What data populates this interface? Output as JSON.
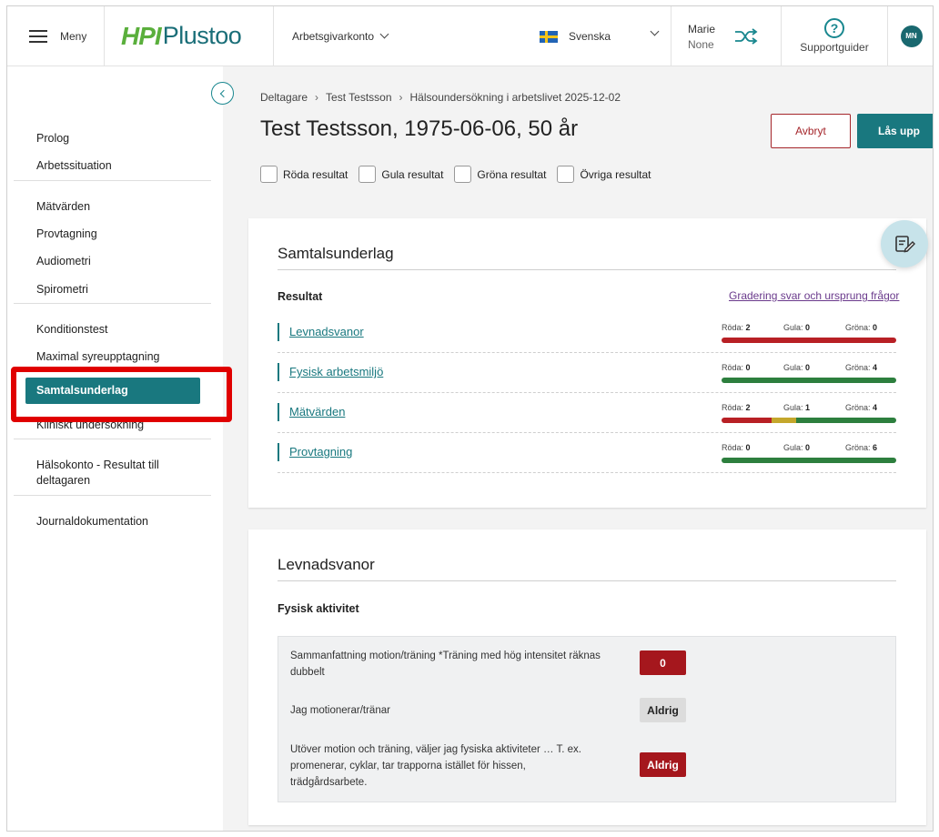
{
  "header": {
    "menu_label": "Meny",
    "logo_hpi": "HPI",
    "logo_plustoo": "Plustoo",
    "account_label": "Arbetsgivarkonto",
    "language_label": "Svenska",
    "user_name": "Marie",
    "user_sub": "None",
    "support_label": "Supportguider",
    "avatar_initials": "MN"
  },
  "sidebar": {
    "items": [
      "Prolog",
      "Arbetssituation",
      "Mätvärden",
      "Provtagning",
      "Audiometri",
      "Spirometri",
      "Konditionstest",
      "Maximal syreupptagning",
      "Samtalsunderlag",
      "Kliniskt undersökning",
      "Hälsokonto - Resultat till deltagaren",
      "Journaldokumentation"
    ],
    "active_item": "Samtalsunderlag"
  },
  "breadcrumb": {
    "items": [
      "Deltagare",
      "Test Testsson",
      "Hälsoundersökning i arbetslivet 2025-12-02"
    ],
    "separator": "›"
  },
  "page": {
    "title": "Test Testsson, 1975-06-06, 50 år",
    "cancel_label": "Avbryt",
    "unlock_label": "Lås upp"
  },
  "filters": [
    "Röda resultat",
    "Gula resultat",
    "Gröna resultat",
    "Övriga resultat"
  ],
  "summary_card": {
    "title": "Samtalsunderlag",
    "results_heading": "Resultat",
    "grading_link": "Gradering svar och ursprung frågor",
    "count_labels": {
      "red": "Röda:",
      "yellow": "Gula:",
      "green": "Gröna:"
    },
    "rows": [
      {
        "name": "Levnadsvanor",
        "red": "2",
        "yellow": "0",
        "green": "0"
      },
      {
        "name": "Fysisk arbetsmiljö",
        "red": "0",
        "yellow": "0",
        "green": "4"
      },
      {
        "name": "Mätvärden",
        "red": "2",
        "yellow": "1",
        "green": "4"
      },
      {
        "name": "Provtagning",
        "red": "0",
        "yellow": "0",
        "green": "6"
      }
    ]
  },
  "habits_card": {
    "title": "Levnadsvanor",
    "subheading": "Fysisk aktivitet",
    "questions": [
      {
        "text": "Sammanfattning motion/träning *Träning med hög intensitet räknas dubbelt",
        "answer": "0",
        "status": "red"
      },
      {
        "text": "Jag motionerar/tränar",
        "answer": "Aldrig",
        "status": "none"
      },
      {
        "text": "Utöver motion och träning, väljer jag fysiska aktiviteter … T. ex. promenerar, cyklar, tar trapporna istället för hissen, trädgårdsarbete.",
        "answer": "Aldrig",
        "status": "red"
      }
    ]
  },
  "colors": {
    "accent": "#19787f",
    "red": "#b82025",
    "yellow": "#c4a72c",
    "green": "#2d7f3e",
    "highlight": "#e00000"
  },
  "icons": {
    "menu": "hamburger-icon",
    "shuffle": "shuffle-icon",
    "support": "question-circle-icon",
    "collapse": "chevron-left-icon",
    "notes": "notes-edit-icon"
  }
}
